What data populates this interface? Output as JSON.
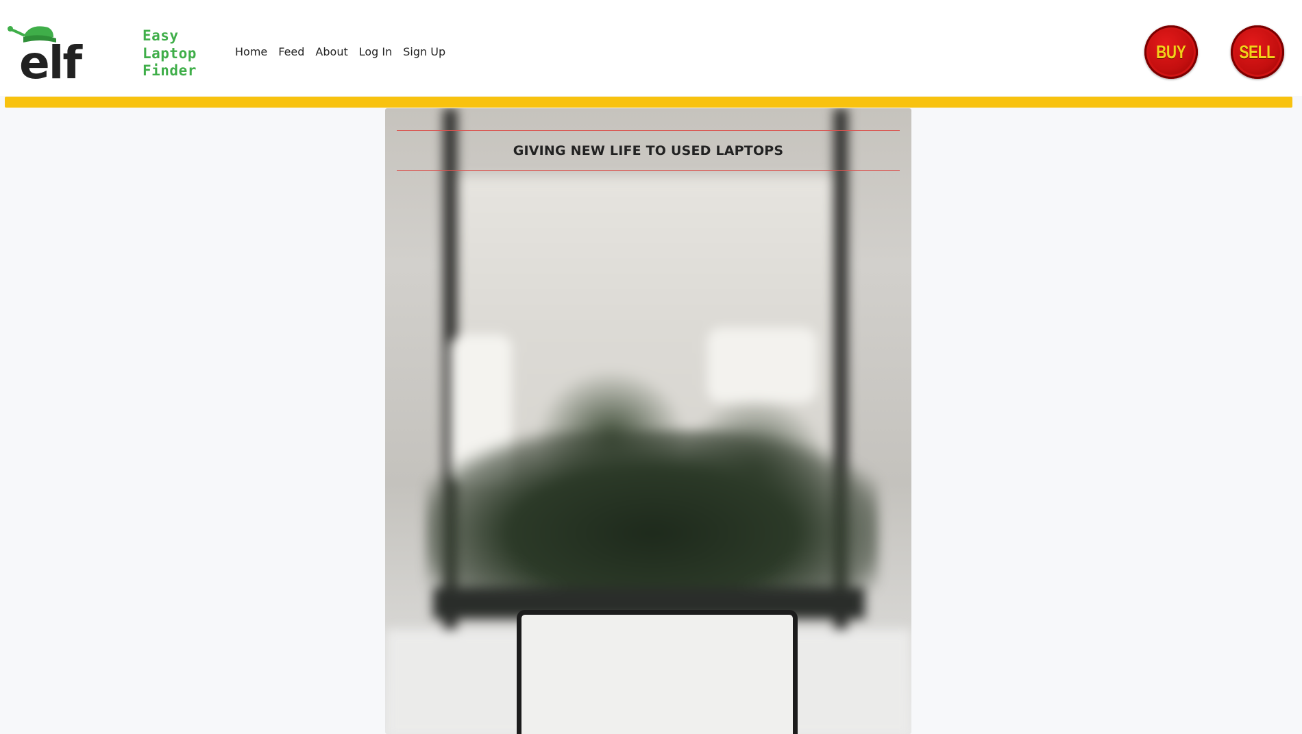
{
  "brand": {
    "logo_letters": "elf",
    "tagline_lines": [
      "Easy",
      "Laptop",
      "Finder"
    ],
    "colors": {
      "logo_dark": "#222222",
      "logo_green": "#3fae49"
    }
  },
  "nav": {
    "items": [
      {
        "label": "Home"
      },
      {
        "label": "Feed"
      },
      {
        "label": "About"
      },
      {
        "label": "Log In"
      },
      {
        "label": "Sign Up"
      }
    ]
  },
  "actions": {
    "buy_label": "BUY",
    "sell_label": "SELL",
    "button_color": "#c40f0f",
    "label_color": "#f3d21a"
  },
  "accent_bar_color": "#f8c20f",
  "hero": {
    "title": "GIVING NEW LIFE TO USED LAPTOPS",
    "rule_color": "#d9534f",
    "image_subject": "blurred-office-plants-with-laptop"
  }
}
